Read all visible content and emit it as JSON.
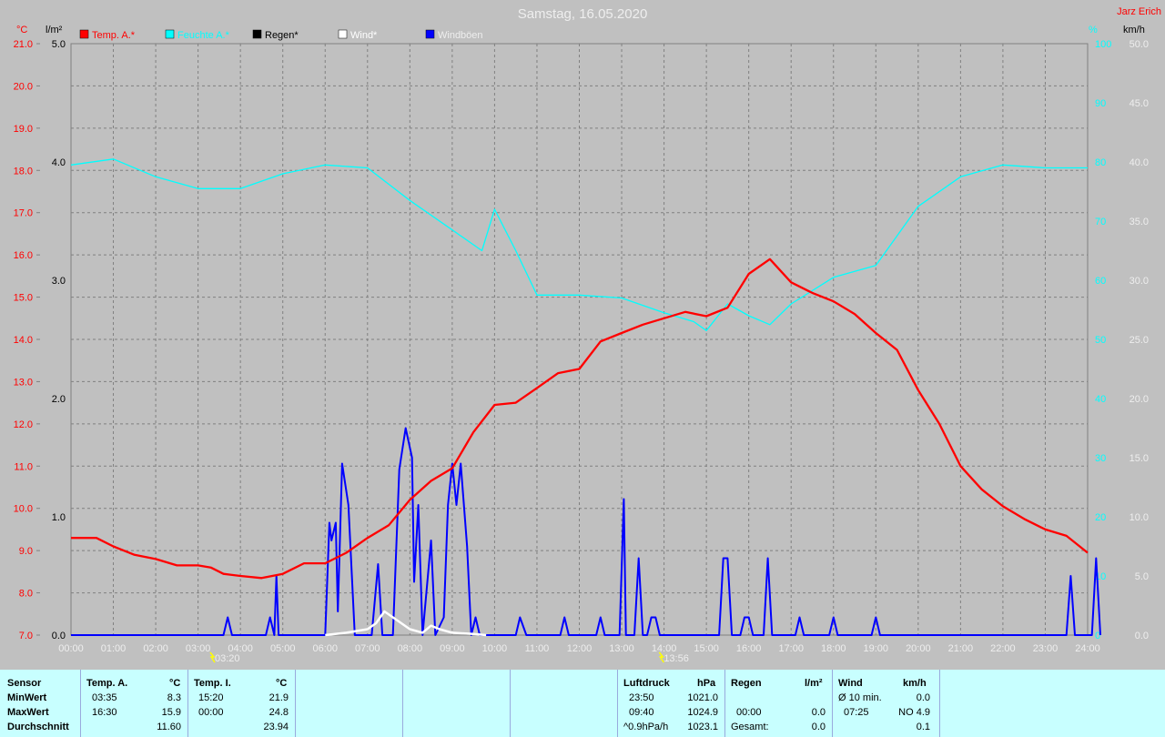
{
  "title": "Samstag, 16.05.2020",
  "author": "Jarz Erich",
  "legend": [
    {
      "label": "Temp. A.*",
      "color": "#ff0000"
    },
    {
      "label": "Feuchte A.*",
      "color": "#00ffff"
    },
    {
      "label": "Regen*",
      "color": "#000000"
    },
    {
      "label": "Wind*",
      "color": "#ffffff"
    },
    {
      "label": "Windböen",
      "color": "#0000ff"
    }
  ],
  "axis_units": {
    "temp": "°C",
    "rain": "l/m²",
    "hum": "%",
    "wind": "km/h"
  },
  "markers": [
    {
      "time": 3.33,
      "label": "03:20"
    },
    {
      "time": 13.93,
      "label": "13:56"
    }
  ],
  "chart_data": {
    "type": "line",
    "x_unit": "hour",
    "xlim": [
      0,
      24
    ],
    "x_ticks": [
      "00:00",
      "01:00",
      "02:00",
      "03:00",
      "04:00",
      "05:00",
      "06:00",
      "07:00",
      "08:00",
      "09:00",
      "10:00",
      "11:00",
      "12:00",
      "13:00",
      "14:00",
      "15:00",
      "16:00",
      "17:00",
      "18:00",
      "19:00",
      "20:00",
      "21:00",
      "22:00",
      "23:00",
      "24:00"
    ],
    "axes": {
      "temp": {
        "range": [
          7,
          21
        ],
        "ticks": [
          "7.0",
          "8.0",
          "9.0",
          "10.0",
          "11.0",
          "12.0",
          "13.0",
          "14.0",
          "15.0",
          "16.0",
          "17.0",
          "18.0",
          "19.0",
          "20.0",
          "21.0"
        ]
      },
      "rain": {
        "range": [
          0,
          5
        ],
        "ticks": [
          "0.0",
          "1.0",
          "2.0",
          "3.0",
          "4.0",
          "5.0"
        ]
      },
      "hum": {
        "range": [
          0,
          100
        ],
        "ticks": [
          "0",
          "10",
          "20",
          "30",
          "40",
          "50",
          "60",
          "70",
          "80",
          "90",
          "100"
        ]
      },
      "wind": {
        "range": [
          0,
          50
        ],
        "ticks": [
          "0.0",
          "5.0",
          "10.0",
          "15.0",
          "20.0",
          "25.0",
          "30.0",
          "35.0",
          "40.0",
          "45.0",
          "50.0"
        ]
      }
    },
    "grid": true,
    "series": [
      {
        "name": "Temp. A.*",
        "axis": "temp",
        "color": "#ff0000",
        "points": [
          [
            0,
            9.3
          ],
          [
            0.6,
            9.3
          ],
          [
            1,
            9.1
          ],
          [
            1.5,
            8.9
          ],
          [
            2,
            8.8
          ],
          [
            2.5,
            8.65
          ],
          [
            3,
            8.65
          ],
          [
            3.3,
            8.6
          ],
          [
            3.6,
            8.45
          ],
          [
            4,
            8.4
          ],
          [
            4.5,
            8.35
          ],
          [
            5,
            8.45
          ],
          [
            5.5,
            8.7
          ],
          [
            6,
            8.7
          ],
          [
            6.5,
            8.95
          ],
          [
            7,
            9.3
          ],
          [
            7.5,
            9.6
          ],
          [
            8,
            10.2
          ],
          [
            8.5,
            10.65
          ],
          [
            9,
            10.95
          ],
          [
            9.5,
            11.8
          ],
          [
            10,
            12.45
          ],
          [
            10.5,
            12.5
          ],
          [
            11,
            12.85
          ],
          [
            11.5,
            13.2
          ],
          [
            12,
            13.3
          ],
          [
            12.5,
            13.95
          ],
          [
            13,
            14.15
          ],
          [
            13.5,
            14.35
          ],
          [
            14,
            14.5
          ],
          [
            14.5,
            14.65
          ],
          [
            15,
            14.55
          ],
          [
            15.5,
            14.75
          ],
          [
            16,
            15.55
          ],
          [
            16.5,
            15.9
          ],
          [
            17,
            15.35
          ],
          [
            17.5,
            15.1
          ],
          [
            18,
            14.9
          ],
          [
            18.5,
            14.6
          ],
          [
            19,
            14.15
          ],
          [
            19.5,
            13.75
          ],
          [
            20,
            12.8
          ],
          [
            20.5,
            12.0
          ],
          [
            21,
            11.0
          ],
          [
            21.5,
            10.45
          ],
          [
            22,
            10.05
          ],
          [
            22.5,
            9.75
          ],
          [
            23,
            9.5
          ],
          [
            23.5,
            9.35
          ],
          [
            24,
            8.95
          ]
        ]
      },
      {
        "name": "Feuchte A.*",
        "axis": "hum",
        "color": "#00ffff",
        "points": [
          [
            0,
            79.5
          ],
          [
            1,
            80.5
          ],
          [
            2,
            77.5
          ],
          [
            3,
            75.5
          ],
          [
            4,
            75.5
          ],
          [
            5,
            78
          ],
          [
            6,
            79.5
          ],
          [
            7,
            79
          ],
          [
            8,
            73.5
          ],
          [
            9,
            68.5
          ],
          [
            9.7,
            65
          ],
          [
            10,
            72
          ],
          [
            10.5,
            65
          ],
          [
            11,
            57.5
          ],
          [
            12,
            57.5
          ],
          [
            13,
            57
          ],
          [
            14,
            54.5
          ],
          [
            14.7,
            53
          ],
          [
            15,
            51.5
          ],
          [
            15.5,
            56
          ],
          [
            16,
            54
          ],
          [
            16.5,
            52.5
          ],
          [
            17,
            56
          ],
          [
            18,
            60.5
          ],
          [
            19,
            62.5
          ],
          [
            20,
            72.5
          ],
          [
            21,
            77.5
          ],
          [
            22,
            79.5
          ],
          [
            23,
            79
          ],
          [
            24,
            79
          ]
        ]
      },
      {
        "name": "Wind*",
        "axis": "wind",
        "color": "#ffffff",
        "points": [
          [
            6,
            0
          ],
          [
            6.5,
            0.2
          ],
          [
            7,
            0.5
          ],
          [
            7.2,
            1
          ],
          [
            7.4,
            2
          ],
          [
            7.6,
            1.5
          ],
          [
            7.8,
            1
          ],
          [
            8,
            0.5
          ],
          [
            8.3,
            0.2
          ],
          [
            8.5,
            0.8
          ],
          [
            8.7,
            0.5
          ],
          [
            9,
            0.2
          ],
          [
            9.5,
            0.1
          ],
          [
            9.8,
            0
          ]
        ]
      },
      {
        "name": "Windböen",
        "axis": "wind",
        "color": "#0000ff",
        "points": [
          [
            0,
            0
          ],
          [
            3.6,
            0
          ],
          [
            3.7,
            1.5
          ],
          [
            3.8,
            0
          ],
          [
            4.6,
            0
          ],
          [
            4.7,
            1.5
          ],
          [
            4.8,
            0
          ],
          [
            4.85,
            5
          ],
          [
            4.9,
            0
          ],
          [
            6,
            0
          ],
          [
            6.1,
            9.5
          ],
          [
            6.15,
            8
          ],
          [
            6.25,
            9.5
          ],
          [
            6.3,
            2
          ],
          [
            6.4,
            14.5
          ],
          [
            6.55,
            11
          ],
          [
            6.7,
            0
          ],
          [
            7.1,
            0
          ],
          [
            7.25,
            6
          ],
          [
            7.35,
            0
          ],
          [
            7.6,
            0
          ],
          [
            7.75,
            14
          ],
          [
            7.9,
            17.5
          ],
          [
            8.05,
            15
          ],
          [
            8.1,
            4.5
          ],
          [
            8.2,
            11
          ],
          [
            8.3,
            0
          ],
          [
            8.5,
            8
          ],
          [
            8.6,
            0
          ],
          [
            8.8,
            1.5
          ],
          [
            8.9,
            11
          ],
          [
            9.0,
            14.5
          ],
          [
            9.1,
            11
          ],
          [
            9.2,
            14.5
          ],
          [
            9.35,
            7.5
          ],
          [
            9.45,
            0
          ],
          [
            9.55,
            1.5
          ],
          [
            9.65,
            0
          ],
          [
            10.5,
            0
          ],
          [
            10.6,
            1.5
          ],
          [
            10.75,
            0
          ],
          [
            11.55,
            0
          ],
          [
            11.65,
            1.5
          ],
          [
            11.75,
            0
          ],
          [
            12.4,
            0
          ],
          [
            12.5,
            1.5
          ],
          [
            12.6,
            0
          ],
          [
            12.95,
            0
          ],
          [
            13.05,
            11.5
          ],
          [
            13.1,
            0
          ],
          [
            13.3,
            0
          ],
          [
            13.4,
            6.5
          ],
          [
            13.5,
            0
          ],
          [
            13.6,
            0
          ],
          [
            13.7,
            1.5
          ],
          [
            13.8,
            1.5
          ],
          [
            13.9,
            0
          ],
          [
            15.3,
            0
          ],
          [
            15.4,
            6.5
          ],
          [
            15.5,
            6.5
          ],
          [
            15.6,
            0
          ],
          [
            15.8,
            0
          ],
          [
            15.9,
            1.5
          ],
          [
            16.0,
            1.5
          ],
          [
            16.1,
            0
          ],
          [
            16.35,
            0
          ],
          [
            16.45,
            6.5
          ],
          [
            16.55,
            0
          ],
          [
            17.1,
            0
          ],
          [
            17.2,
            1.5
          ],
          [
            17.3,
            0
          ],
          [
            17.9,
            0
          ],
          [
            18.0,
            1.5
          ],
          [
            18.1,
            0
          ],
          [
            18.9,
            0
          ],
          [
            19.0,
            1.5
          ],
          [
            19.1,
            0
          ],
          [
            23.5,
            0
          ],
          [
            23.6,
            5
          ],
          [
            23.7,
            0
          ],
          [
            24.1,
            0
          ],
          [
            24.2,
            6.5
          ],
          [
            24.3,
            0
          ]
        ]
      },
      {
        "name": "Regen*",
        "axis": "rain",
        "color": "#000000",
        "points": [
          [
            0,
            0
          ],
          [
            24,
            0
          ]
        ]
      }
    ]
  },
  "stats": {
    "sensor": {
      "header": "Sensor",
      "rows": [
        "MinWert",
        "MaxWert",
        "Durchschnitt"
      ]
    },
    "temp_a": {
      "header": "Temp. A.",
      "unit": "°C",
      "rows": [
        [
          "03:35",
          "8.3"
        ],
        [
          "16:30",
          "15.9"
        ],
        [
          "",
          "11.60"
        ]
      ]
    },
    "temp_i": {
      "header": "Temp. I.",
      "unit": "°C",
      "rows": [
        [
          "15:20",
          "21.9"
        ],
        [
          "00:00",
          "24.8"
        ],
        [
          "",
          "23.94"
        ]
      ]
    },
    "pressure": {
      "header": "Luftdruck",
      "unit": "hPa",
      "rows": [
        [
          "23:50",
          "1021.0"
        ],
        [
          "09:40",
          "1024.9"
        ],
        [
          "^0.9hPa/h",
          "1023.1"
        ]
      ]
    },
    "rain": {
      "header": "Regen",
      "unit": "l/m²",
      "rows": [
        [
          "",
          ""
        ],
        [
          "00:00",
          "0.0"
        ],
        [
          "Gesamt:",
          "0.0"
        ]
      ]
    },
    "wind": {
      "header": "Wind",
      "unit": "km/h",
      "rows": [
        [
          "Ø 10 min.",
          "0.0"
        ],
        [
          "07:25",
          "NO 4.9"
        ],
        [
          "",
          "0.1"
        ]
      ]
    }
  }
}
